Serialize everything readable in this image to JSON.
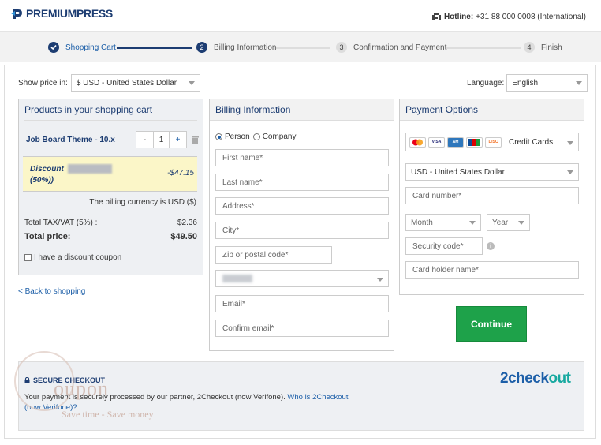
{
  "header": {
    "logo": "PREMIUMPRESS",
    "hotline_label": "Hotline:",
    "hotline_value": "+31 88 000 0008 (International)"
  },
  "steps": [
    {
      "num": "",
      "label": "Shopping Cart"
    },
    {
      "num": "2",
      "label": "Billing Information"
    },
    {
      "num": "3",
      "label": "Confirmation and Payment"
    },
    {
      "num": "4",
      "label": "Finish"
    }
  ],
  "toolbar": {
    "show_price_label": "Show price in:",
    "currency": "$ USD - United States Dollar",
    "language_label": "Language:",
    "language": "English"
  },
  "cart": {
    "title": "Products in your shopping cart",
    "product_name": "Job Board Theme - 10.x",
    "qty_minus": "-",
    "qty": "1",
    "qty_plus": "+",
    "discount_label": "Discount",
    "discount_pct": "(50%))",
    "discount_value": "-$47.15",
    "billing_currency": "The billing currency is USD ($)",
    "tax_label": "Total TAX/VAT (5%) :",
    "tax_value": "$2.36",
    "total_label": "Total price:",
    "total_value": "$49.50",
    "coupon_label": "I have a discount coupon",
    "back_link": "< Back to shopping"
  },
  "billing": {
    "title": "Billing Information",
    "person": "Person",
    "company": "Company",
    "first_name": "First name*",
    "last_name": "Last name*",
    "address": "Address*",
    "city": "City*",
    "zip": "Zip or postal code*",
    "email": "Email*",
    "confirm_email": "Confirm email*"
  },
  "payment": {
    "title": "Payment Options",
    "card_label": "Credit Cards",
    "currency": "USD - United States Dollar",
    "card_number": "Card number*",
    "month": "Month",
    "year": "Year",
    "security_code": "Security code*",
    "holder": "Card holder name*",
    "continue": "Continue"
  },
  "secure": {
    "title": "SECURE CHECKOUT",
    "text": "Your payment is securely processed by our partner, 2Checkout (now Verifone). ",
    "link": "Who is 2Checkout (now Verifone)?",
    "logo_a": "2check",
    "logo_b": "out"
  },
  "watermark": {
    "text": "oupon",
    "tagline": "Save time - Save money"
  },
  "colors": {
    "brand": "#1d3d72",
    "accent": "#1d5fa8",
    "continue": "#1ea24a",
    "discount_bg": "#fbf6c8"
  }
}
